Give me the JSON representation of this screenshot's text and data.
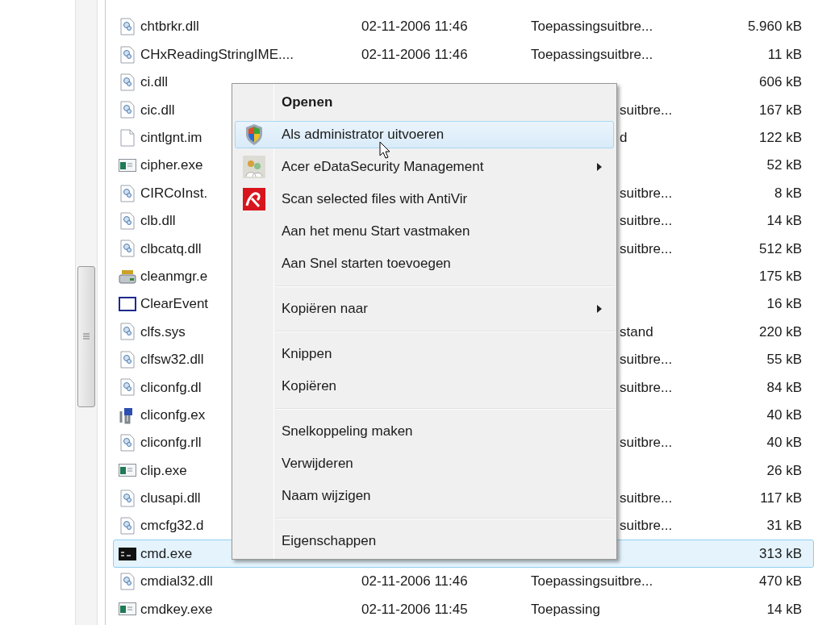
{
  "files": [
    {
      "kind": "dll",
      "name": "chtbrkr.dll",
      "date": "02-11-2006 11:46",
      "type": "Toepassingsuitbre...",
      "size": "5.960 kB",
      "selected": false
    },
    {
      "kind": "dll",
      "name": "CHxReadingStringIME....",
      "date": "02-11-2006 11:46",
      "type": "Toepassingsuitbre...",
      "size": "11 kB",
      "selected": false
    },
    {
      "kind": "dll",
      "name": "ci.dll",
      "size": "606 kB",
      "selected": false
    },
    {
      "kind": "dll",
      "name": "cic.dll",
      "type_fragment": "suitbre...",
      "size": "167 kB",
      "selected": false
    },
    {
      "kind": "blank",
      "name": "cintlgnt.im",
      "type_fragment": "d",
      "size": "122 kB",
      "selected": false
    },
    {
      "kind": "exe",
      "name": "cipher.exe",
      "size": "52 kB",
      "selected": false
    },
    {
      "kind": "dll",
      "name": "CIRCoInst.",
      "type_fragment": "suitbre...",
      "size": "8 kB",
      "selected": false
    },
    {
      "kind": "dll",
      "name": "clb.dll",
      "type_fragment": "suitbre...",
      "size": "14 kB",
      "selected": false
    },
    {
      "kind": "dll",
      "name": "clbcatq.dll",
      "type_fragment": "suitbre...",
      "size": "512 kB",
      "selected": false
    },
    {
      "kind": "cleaner",
      "name": "cleanmgr.e",
      "size": "175 kB",
      "selected": false
    },
    {
      "kind": "window",
      "name": "ClearEvent",
      "size": "16 kB",
      "selected": false
    },
    {
      "kind": "dll",
      "name": "clfs.sys",
      "type_fragment": "stand",
      "size": "220 kB",
      "selected": false
    },
    {
      "kind": "dll",
      "name": "clfsw32.dll",
      "type_fragment": "suitbre...",
      "size": "55 kB",
      "selected": false
    },
    {
      "kind": "dll",
      "name": "cliconfg.dl",
      "type_fragment": "suitbre...",
      "size": "84 kB",
      "selected": false
    },
    {
      "kind": "config",
      "name": "cliconfg.ex",
      "size": "40 kB",
      "selected": false
    },
    {
      "kind": "dll",
      "name": "cliconfg.rll",
      "type_fragment": "suitbre...",
      "size": "40 kB",
      "selected": false
    },
    {
      "kind": "exe",
      "name": "clip.exe",
      "size": "26 kB",
      "selected": false
    },
    {
      "kind": "dll",
      "name": "clusapi.dll",
      "type_fragment": "suitbre...",
      "size": "117 kB",
      "selected": false
    },
    {
      "kind": "dll",
      "name": "cmcfg32.d",
      "type_fragment": "suitbre...",
      "size": "31 kB",
      "selected": false
    },
    {
      "kind": "console",
      "name": "cmd.exe",
      "size": "313 kB",
      "selected": true
    },
    {
      "kind": "dll",
      "name": "cmdial32.dll",
      "date": "02-11-2006 11:46",
      "type": "Toepassingsuitbre...",
      "size": "470 kB",
      "selected": false
    },
    {
      "kind": "exe",
      "name": "cmdkey.exe",
      "date": "02-11-2006 11:45",
      "type": "Toepassing",
      "size": "14 kB",
      "selected": false
    }
  ],
  "context_menu": [
    {
      "kind": "item",
      "label": "Openen",
      "bold": true,
      "selected": false
    },
    {
      "kind": "item",
      "label": "Als administrator uitvoeren",
      "selected": true
    },
    {
      "kind": "item",
      "label": "Acer eDataSecurity Management",
      "submenu": true,
      "selected": false
    },
    {
      "kind": "item",
      "label": "Scan selected files with AntiVir",
      "selected": false
    },
    {
      "kind": "item",
      "label": "Aan het menu Start vastmaken",
      "selected": false
    },
    {
      "kind": "item",
      "label": "Aan Snel starten toevoegen",
      "selected": false
    },
    {
      "kind": "separator"
    },
    {
      "kind": "item",
      "label": "Kopiëren naar",
      "submenu": true,
      "selected": false
    },
    {
      "kind": "separator"
    },
    {
      "kind": "item",
      "label": "Knippen",
      "selected": false
    },
    {
      "kind": "item",
      "label": "Kopiëren",
      "selected": false
    },
    {
      "kind": "separator"
    },
    {
      "kind": "item",
      "label": "Snelkoppeling maken",
      "selected": false
    },
    {
      "kind": "item",
      "label": "Verwijderen",
      "selected": false
    },
    {
      "kind": "item",
      "label": "Naam wijzigen",
      "selected": false
    },
    {
      "kind": "separator"
    },
    {
      "kind": "item",
      "label": "Eigenschappen",
      "selected": false
    }
  ]
}
